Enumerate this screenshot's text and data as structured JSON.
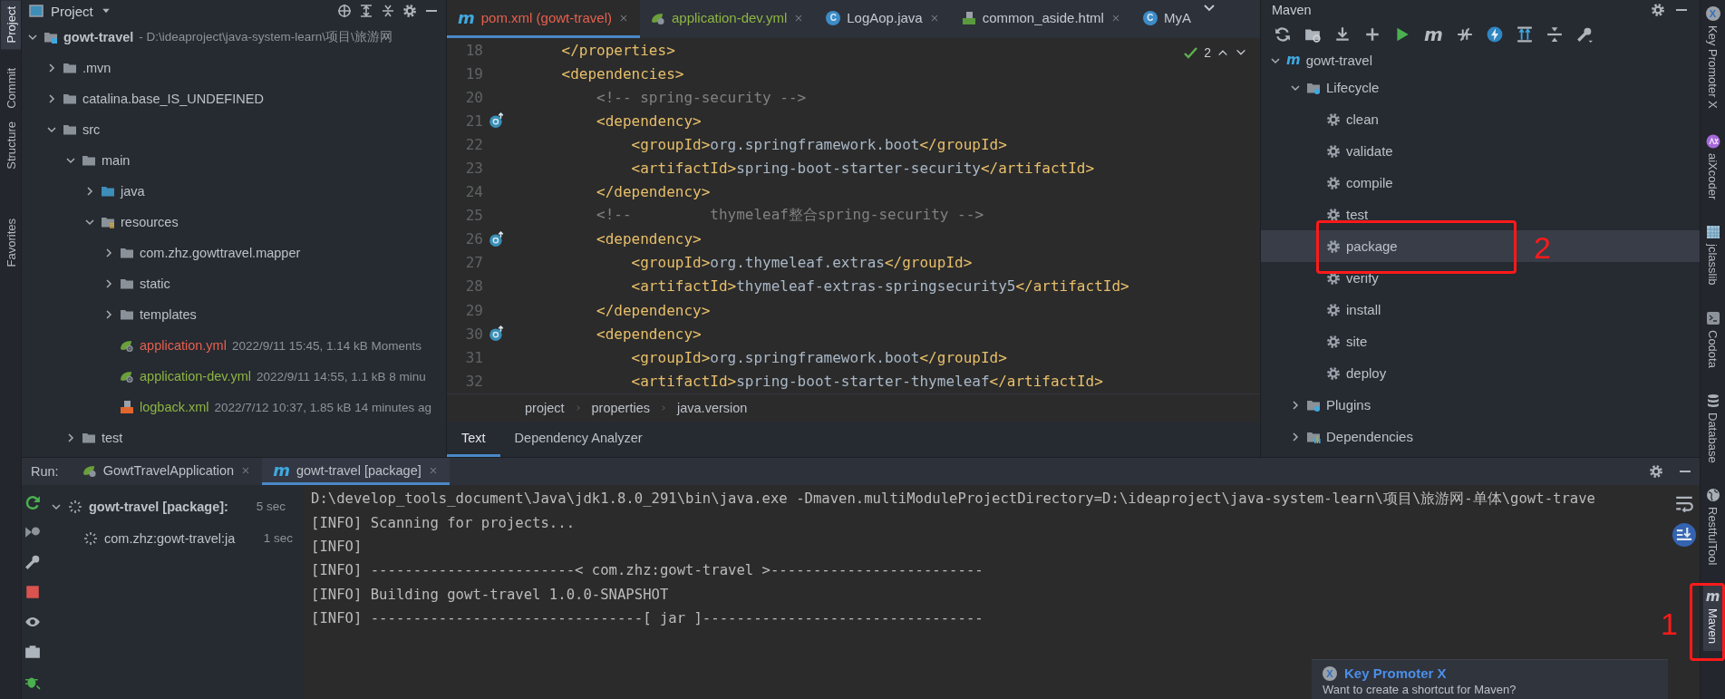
{
  "left_stripe": {
    "top": [
      {
        "label": "Project",
        "selected": true
      },
      {
        "label": "Commit",
        "selected": false
      }
    ],
    "bottom": [
      {
        "label": "Structure",
        "selected": false
      },
      {
        "label": "Favorites",
        "selected": false
      }
    ]
  },
  "project": {
    "title": "Project",
    "tree": [
      {
        "name": "gowt-travel",
        "kind": "module",
        "path": "- D:\\ideaproject\\java-system-learn\\项目\\旅游网",
        "expanded": true,
        "children": [
          {
            "name": ".mvn",
            "kind": "folder",
            "expanded": false
          },
          {
            "name": "catalina.base_IS_UNDEFINED",
            "kind": "folder",
            "expanded": false
          },
          {
            "name": "src",
            "kind": "folder",
            "expanded": true,
            "children": [
              {
                "name": "main",
                "kind": "folder",
                "expanded": true,
                "children": [
                  {
                    "name": "java",
                    "kind": "source-folder",
                    "expanded": false
                  },
                  {
                    "name": "resources",
                    "kind": "resource-folder",
                    "expanded": true,
                    "children": [
                      {
                        "name": "com.zhz.gowttravel.mapper",
                        "kind": "folder",
                        "expanded": false
                      },
                      {
                        "name": "static",
                        "kind": "folder",
                        "expanded": false
                      },
                      {
                        "name": "templates",
                        "kind": "folder",
                        "expanded": false
                      },
                      {
                        "name": "application.yml",
                        "kind": "spring-file",
                        "color": "#e5604f",
                        "meta": "2022/9/11 15:45, 1.14 kB Moments"
                      },
                      {
                        "name": "application-dev.yml",
                        "kind": "spring-file",
                        "color": "#8db542",
                        "meta": "2022/9/11 14:55, 1.1 kB 8 minu"
                      },
                      {
                        "name": "logback.xml",
                        "kind": "xml-file",
                        "color": "#8db542",
                        "meta": "2022/7/12 10:37, 1.85 kB 14 minutes ag"
                      }
                    ]
                  }
                ]
              },
              {
                "name": "test",
                "kind": "folder",
                "expanded": false
              }
            ]
          }
        ]
      }
    ]
  },
  "editor": {
    "tabs": [
      {
        "label": "pom.xml (gowt-travel)",
        "kind": "maven",
        "glyph": "m",
        "color": "#e5604f",
        "selected": true,
        "closable": true
      },
      {
        "label": "application-dev.yml",
        "kind": "spring",
        "color": "#8db542",
        "selected": false,
        "closable": true
      },
      {
        "label": "LogAop.java",
        "kind": "class",
        "glyph": "C",
        "color": "#c4c9d1",
        "selected": false,
        "closable": true
      },
      {
        "label": "common_aside.html",
        "kind": "html",
        "color": "#c4c9d1",
        "selected": false,
        "closable": true
      },
      {
        "label": "MyA",
        "kind": "class",
        "glyph": "C",
        "color": "#c4c9d1",
        "selected": false,
        "closable": false
      }
    ],
    "inspection": {
      "count": "2"
    },
    "lines": [
      {
        "number": "18",
        "marker": false,
        "segments": [
          {
            "kind": "tag",
            "text": "    </properties>"
          }
        ]
      },
      {
        "number": "19",
        "marker": false,
        "segments": [
          {
            "kind": "tag",
            "text": "    <dependencies>"
          }
        ]
      },
      {
        "number": "20",
        "marker": false,
        "segments": [
          {
            "kind": "comment",
            "text": "        <!-- spring-security -->"
          }
        ]
      },
      {
        "number": "21",
        "marker": true,
        "segments": [
          {
            "kind": "tag",
            "text": "        <dependency>"
          }
        ]
      },
      {
        "number": "22",
        "marker": false,
        "segments": [
          {
            "kind": "tag",
            "text": "            <groupId>"
          },
          {
            "kind": "text",
            "text": "org.springframework.boot"
          },
          {
            "kind": "tag",
            "text": "</groupId>"
          }
        ]
      },
      {
        "number": "23",
        "marker": false,
        "segments": [
          {
            "kind": "tag",
            "text": "            <artifactId>"
          },
          {
            "kind": "text",
            "text": "spring-boot-starter-security"
          },
          {
            "kind": "tag",
            "text": "</artifactId>"
          }
        ]
      },
      {
        "number": "24",
        "marker": false,
        "segments": [
          {
            "kind": "tag",
            "text": "        </dependency>"
          }
        ]
      },
      {
        "number": "25",
        "marker": false,
        "segments": [
          {
            "kind": "comment",
            "text": "        <!--         thymeleaf整合spring-security -->"
          }
        ]
      },
      {
        "number": "26",
        "marker": true,
        "segments": [
          {
            "kind": "tag",
            "text": "        <dependency>"
          }
        ]
      },
      {
        "number": "27",
        "marker": false,
        "segments": [
          {
            "kind": "tag",
            "text": "            <groupId>"
          },
          {
            "kind": "text",
            "text": "org.thymeleaf.extras"
          },
          {
            "kind": "tag",
            "text": "</groupId>"
          }
        ]
      },
      {
        "number": "28",
        "marker": false,
        "segments": [
          {
            "kind": "tag",
            "text": "            <artifactId>"
          },
          {
            "kind": "text",
            "text": "thymeleaf-extras-springsecurity5"
          },
          {
            "kind": "tag",
            "text": "</artifactId>"
          }
        ]
      },
      {
        "number": "29",
        "marker": false,
        "segments": [
          {
            "kind": "tag",
            "text": "        </dependency>"
          }
        ]
      },
      {
        "number": "30",
        "marker": true,
        "segments": [
          {
            "kind": "tag",
            "text": "        <dependency>"
          }
        ]
      },
      {
        "number": "31",
        "marker": false,
        "segments": [
          {
            "kind": "tag",
            "text": "            <groupId>"
          },
          {
            "kind": "text",
            "text": "org.springframework.boot"
          },
          {
            "kind": "tag",
            "text": "</groupId>"
          }
        ]
      },
      {
        "number": "32",
        "marker": false,
        "segments": [
          {
            "kind": "tag",
            "text": "            <artifactId>"
          },
          {
            "kind": "text",
            "text": "spring-boot-starter-thymeleaf"
          },
          {
            "kind": "tag",
            "text": "</artifactId>"
          }
        ]
      }
    ],
    "breadcrumb": [
      "project",
      "properties",
      "java.version"
    ],
    "bottom_tabs": [
      {
        "label": "Text",
        "selected": true
      },
      {
        "label": "Dependency Analyzer",
        "selected": false
      }
    ]
  },
  "maven": {
    "title": "Maven",
    "toolbar": [
      {
        "kind": "reload"
      },
      {
        "kind": "folder-reload"
      },
      {
        "kind": "download"
      },
      {
        "kind": "add"
      },
      {
        "kind": "run"
      },
      {
        "kind": "goal",
        "glyph": "m"
      },
      {
        "kind": "skip-tests"
      },
      {
        "kind": "offline"
      },
      {
        "kind": "expand"
      },
      {
        "kind": "collapse"
      },
      {
        "kind": "settings"
      }
    ],
    "tree": [
      {
        "name": "gowt-travel",
        "kind": "project",
        "glyph": "m",
        "expanded": true,
        "selected": false,
        "children": [
          {
            "name": "Lifecycle",
            "kind": "group",
            "expanded": true,
            "selected": false,
            "children": [
              {
                "name": "clean",
                "kind": "goal",
                "selected": false
              },
              {
                "name": "validate",
                "kind": "goal",
                "selected": false
              },
              {
                "name": "compile",
                "kind": "goal",
                "selected": false
              },
              {
                "name": "test",
                "kind": "goal",
                "selected": false
              },
              {
                "name": "package",
                "kind": "goal",
                "selected": true
              },
              {
                "name": "verify",
                "kind": "goal",
                "selected": false
              },
              {
                "name": "install",
                "kind": "goal",
                "selected": false
              },
              {
                "name": "site",
                "kind": "goal",
                "selected": false
              },
              {
                "name": "deploy",
                "kind": "goal",
                "selected": false
              }
            ]
          },
          {
            "name": "Plugins",
            "kind": "group",
            "expanded": false,
            "selected": false
          },
          {
            "name": "Dependencies",
            "kind": "dependencies",
            "expanded": false,
            "selected": false
          }
        ]
      }
    ]
  },
  "right_stripe": [
    {
      "label": "Key Promoter X",
      "kind": "promoter",
      "glyph": "X",
      "selected": false
    },
    {
      "label": "aiXcoder",
      "kind": "aixcoder",
      "selected": false
    },
    {
      "label": "jclasslib",
      "kind": "grid",
      "selected": false
    },
    {
      "label": "Codota",
      "kind": "terminal",
      "selected": false
    },
    {
      "label": "Database",
      "kind": "database",
      "selected": false
    },
    {
      "label": "RestfulTool",
      "kind": "globe",
      "selected": false
    },
    {
      "label": "Maven",
      "kind": "maven",
      "glyph": "m",
      "selected": true
    }
  ],
  "run": {
    "label": "Run:",
    "tabs": [
      {
        "label": "GowtTravelApplication",
        "kind": "spring",
        "selected": false
      },
      {
        "label": "gowt-travel [package]",
        "kind": "maven",
        "glyph": "m",
        "selected": true
      }
    ],
    "tree": [
      {
        "name": "gowt-travel [package]:",
        "time": "5 sec",
        "expanded": true,
        "children": [
          {
            "name": "com.zhz:gowt-travel:ja",
            "time": "1 sec"
          }
        ]
      }
    ],
    "console": [
      "D:\\develop_tools_document\\Java\\jdk1.8.0_291\\bin\\java.exe -Dmaven.multiModuleProjectDirectory=D:\\ideaproject\\java-system-learn\\项目\\旅游网-单体\\gowt-trave",
      "[INFO] Scanning for projects...",
      "[INFO]",
      "[INFO] ------------------------< com.zhz:gowt-travel >-------------------------",
      "[INFO] Building gowt-travel 1.0.0-SNAPSHOT",
      "[INFO] --------------------------------[ jar ]---------------------------------"
    ],
    "popup": {
      "title": "Key Promoter X",
      "glyph": "X",
      "message": "Want to create a shortcut for Maven?"
    }
  },
  "annotations": [
    {
      "kind": "goal-highlight",
      "label": "2"
    },
    {
      "kind": "stripe-highlight",
      "label": "1"
    }
  ]
}
